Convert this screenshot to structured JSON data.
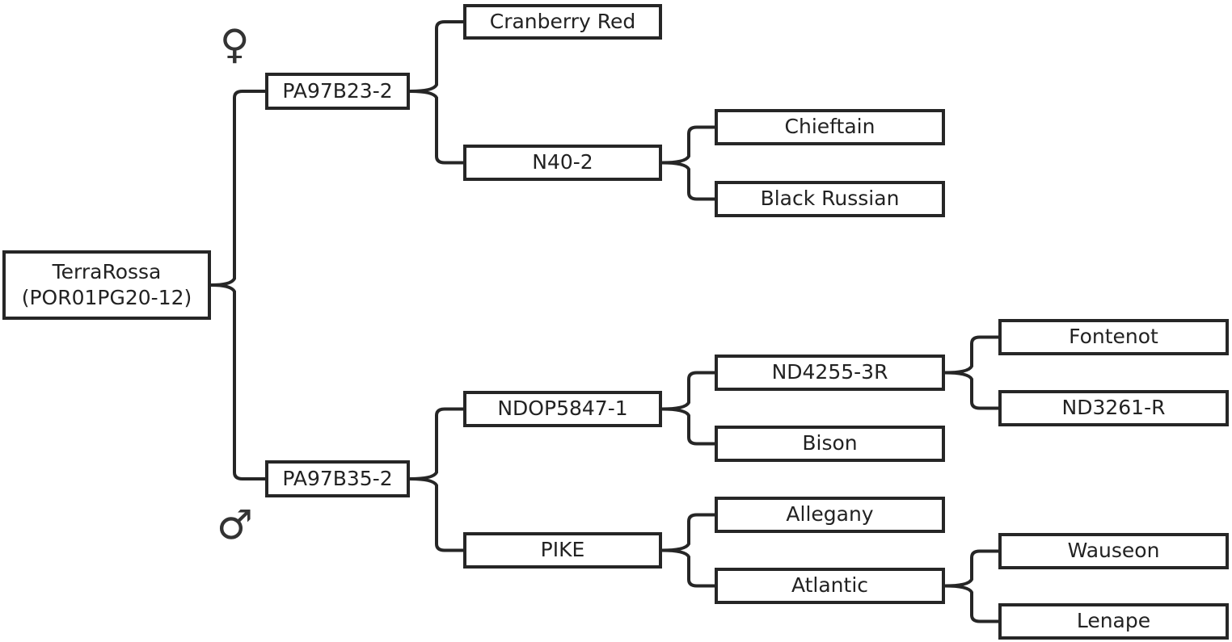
{
  "nodes": {
    "root": {
      "label": "TerraRossa\n(POR01PG20-12)"
    },
    "pa23": {
      "label": "PA97B23-2"
    },
    "pa35": {
      "label": "PA97B35-2"
    },
    "cran": {
      "label": "Cranberry Red"
    },
    "n40": {
      "label": "N40-2"
    },
    "chief": {
      "label": "Chieftain"
    },
    "black": {
      "label": "Black Russian"
    },
    "ndop": {
      "label": "NDOP5847-1"
    },
    "pike": {
      "label": "PIKE"
    },
    "nd4255": {
      "label": "ND4255-3R"
    },
    "bison": {
      "label": "Bison"
    },
    "alleg": {
      "label": "Allegany"
    },
    "atl": {
      "label": "Atlantic"
    },
    "font": {
      "label": "Fontenot"
    },
    "nd3261": {
      "label": "ND3261-R"
    },
    "waus": {
      "label": "Wauseon"
    },
    "lenape": {
      "label": "Lenape"
    }
  },
  "edges": [
    [
      "root",
      "pa23"
    ],
    [
      "root",
      "pa35"
    ],
    [
      "pa23",
      "cran"
    ],
    [
      "pa23",
      "n40"
    ],
    [
      "n40",
      "chief"
    ],
    [
      "n40",
      "black"
    ],
    [
      "pa35",
      "ndop"
    ],
    [
      "pa35",
      "pike"
    ],
    [
      "ndop",
      "nd4255"
    ],
    [
      "ndop",
      "bison"
    ],
    [
      "nd4255",
      "font"
    ],
    [
      "nd4255",
      "nd3261"
    ],
    [
      "pike",
      "alleg"
    ],
    [
      "pike",
      "atl"
    ],
    [
      "atl",
      "waus"
    ],
    [
      "atl",
      "lenape"
    ]
  ],
  "symbols": {
    "female": "♀",
    "male": "♂"
  }
}
